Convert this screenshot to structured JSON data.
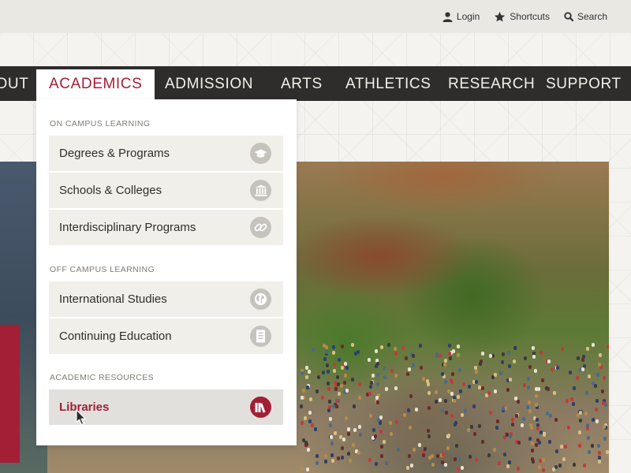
{
  "utility_bar": {
    "login_label": "Login",
    "shortcuts_label": "Shortcuts",
    "search_label": "Search"
  },
  "main_nav": {
    "items": [
      "ABOUT",
      "ACADEMICS",
      "ADMISSION",
      "ARTS",
      "ATHLETICS",
      "RESEARCH",
      "SUPPORT"
    ],
    "active": "ACADEMICS"
  },
  "dropdown": {
    "sections": [
      {
        "heading": "ON CAMPUS LEARNING",
        "items": [
          {
            "label": "Degrees & Programs",
            "icon": "graduation-cap-icon"
          },
          {
            "label": "Schools & Colleges",
            "icon": "building-icon"
          },
          {
            "label": "Interdisciplinary Programs",
            "icon": "link-icon"
          }
        ]
      },
      {
        "heading": "OFF CAMPUS LEARNING",
        "items": [
          {
            "label": "International Studies",
            "icon": "globe-icon"
          },
          {
            "label": "Continuing Education",
            "icon": "book-icon"
          }
        ]
      },
      {
        "heading": "ACADEMIC RESOURCES",
        "items": [
          {
            "label": "Libraries",
            "icon": "library-icon",
            "highlighted": true
          }
        ]
      }
    ]
  },
  "colors": {
    "accent": "#a31f36",
    "nav_background": "#2e2d2b",
    "utility_background": "#eae8e3",
    "item_background": "#f1efea",
    "icon_circle": "#c6c3bc"
  }
}
